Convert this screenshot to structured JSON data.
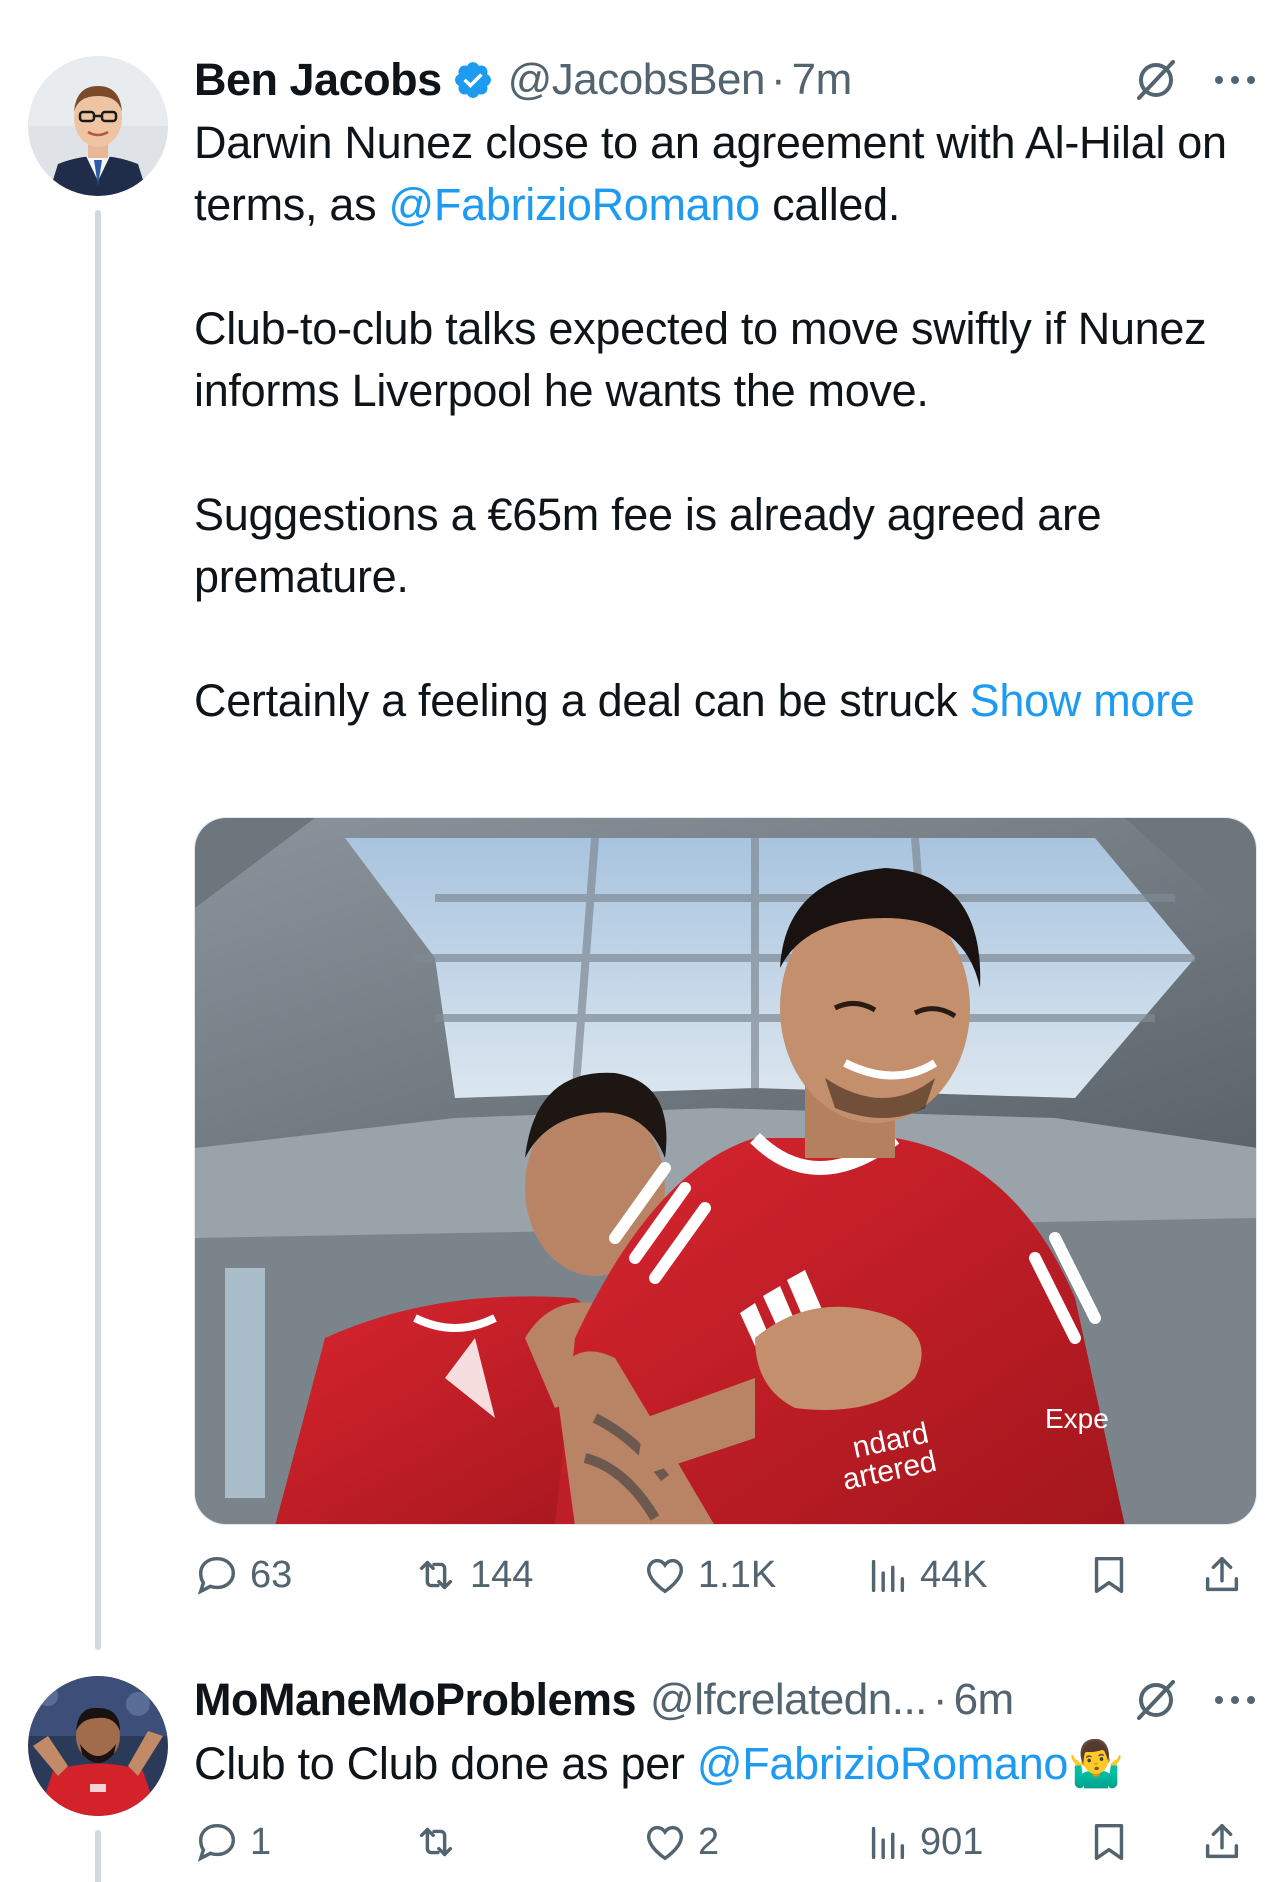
{
  "tweet1": {
    "display_name": "Ben Jacobs",
    "verified": true,
    "handle": "@JacobsBen",
    "separator": "·",
    "time": "7m",
    "text_line1_before": "Darwin Nunez close to an agreement with Al-Hilal on terms, as ",
    "mention": "@FabrizioRomano",
    "text_line1_after": " called.",
    "paragraph2": "Club-to-club talks expected to move swiftly if Nunez informs Liverpool he wants the move.",
    "paragraph3": "Suggestions a €65m fee is already agreed are premature.",
    "paragraph4": "Certainly a feeling a deal can be struck ",
    "show_more": "Show more",
    "media_alt": "Darwin Nunez celebrating in red Liverpool kit",
    "shirt_text1": "ndard",
    "shirt_text2": "artered",
    "shirt_text3": "Expe",
    "replies": "63",
    "reposts": "144",
    "likes": "1.1K",
    "views": "44K"
  },
  "tweet2": {
    "display_name": "MoManeMoProblems",
    "handle": "@lfcrelatedn...",
    "separator": "·",
    "time": "6m",
    "text_before": "Club to Club done as per ",
    "mention": "@FabrizioRomano",
    "emoji": "🤷‍♂️",
    "replies": "1",
    "reposts": "",
    "likes": "2",
    "views": "901"
  },
  "colors": {
    "text": "#0f1419",
    "secondary": "#536471",
    "link": "#1d9bf0",
    "verified": "#1d9bf0"
  },
  "icons": [
    "verified-badge-icon",
    "grok-icon",
    "more-icon",
    "reply-icon",
    "repost-icon",
    "like-icon",
    "views-icon",
    "bookmark-icon",
    "share-icon"
  ]
}
